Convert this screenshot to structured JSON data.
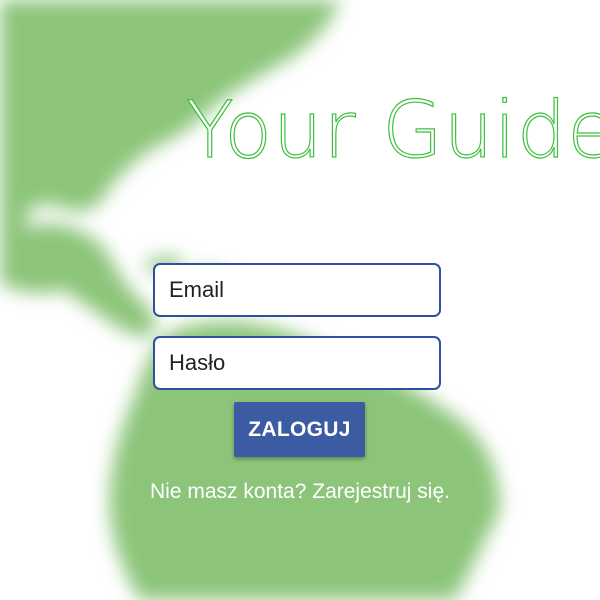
{
  "app": {
    "title": "Your Guide"
  },
  "login_form": {
    "email_placeholder": "Email",
    "password_placeholder": "Hasło",
    "login_button": "ZALOGUJ",
    "register_link": "Nie masz konta? Zarejestruj się."
  },
  "colors": {
    "title_outline": "#3fbf3f",
    "map_green": "#8cc57a",
    "field_border": "#2f4fa0",
    "button_bg": "#3b5ba3",
    "button_text": "#ffffff",
    "register_text": "#ffffff"
  },
  "background": {
    "icon": "world-map-background"
  }
}
